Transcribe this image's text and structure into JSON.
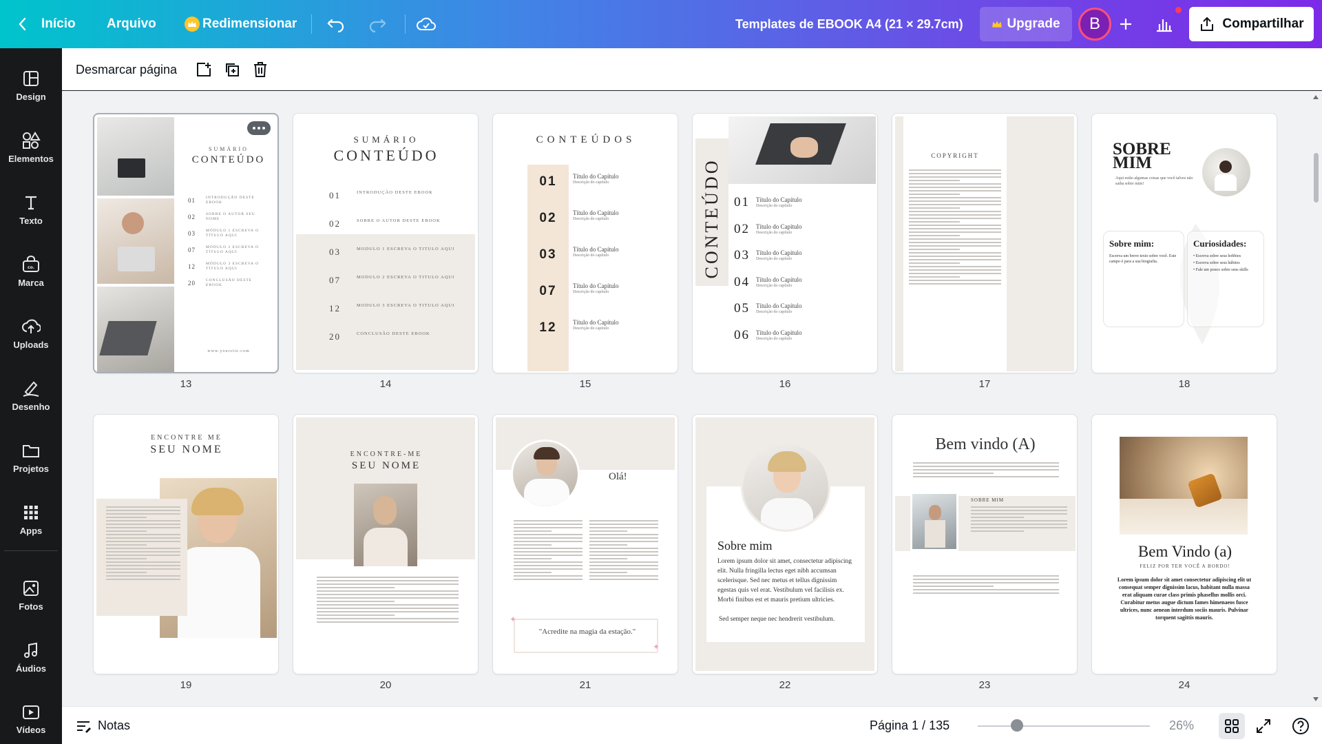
{
  "topbar": {
    "back_label": "Início",
    "file_label": "Arquivo",
    "resize_label": "Redimensionar",
    "doc_title": "Templates de EBOOK A4 (21 × 29.7cm)",
    "upgrade_label": "Upgrade",
    "avatar_initial": "B",
    "share_label": "Compartilhar",
    "colors": {
      "gradient_start": "#00c4cc",
      "gradient_end": "#7d2ae8",
      "avatar": "#7c1fb3"
    }
  },
  "sidebar": {
    "items": [
      {
        "label": "Design",
        "icon": "layout-icon"
      },
      {
        "label": "Elementos",
        "icon": "shapes-icon"
      },
      {
        "label": "Texto",
        "icon": "text-icon"
      },
      {
        "label": "Marca",
        "icon": "brand-icon"
      },
      {
        "label": "Uploads",
        "icon": "upload-cloud-icon"
      },
      {
        "label": "Desenho",
        "icon": "draw-icon"
      },
      {
        "label": "Projetos",
        "icon": "folder-icon"
      },
      {
        "label": "Apps",
        "icon": "apps-grid-icon"
      },
      {
        "label": "Fotos",
        "icon": "photo-icon"
      },
      {
        "label": "Áudios",
        "icon": "music-icon"
      },
      {
        "label": "Vídeos",
        "icon": "video-icon"
      }
    ]
  },
  "pagebar": {
    "deselect_label": "Desmarcar página"
  },
  "pages": {
    "p13": {
      "number": "13",
      "subtitle": "SUMÁRIO",
      "title": "CONTEÚDO",
      "items": [
        {
          "num": "01",
          "text": "INTRODUÇÃO DESTE EBOOK"
        },
        {
          "num": "02",
          "text": "SOBRE O AUTOR SEU NOME"
        },
        {
          "num": "03",
          "text": "MÓDULO 1 ESCREVA O TÍTULO AQUI"
        },
        {
          "num": "07",
          "text": "MÓDULO 2 ESCREVA O TÍTULO AQUI"
        },
        {
          "num": "12",
          "text": "MÓDULO 3 ESCREVA O TÍTULO AQUI"
        },
        {
          "num": "20",
          "text": "CONCLUSÃO DESTE EBOOK"
        }
      ],
      "url": "www.yoursite.com"
    },
    "p14": {
      "number": "14",
      "subtitle": "SUMÁRIO",
      "title": "CONTEÚDO",
      "items": [
        {
          "num": "01",
          "text": "INTRODUÇÃO DESTE EBOOK"
        },
        {
          "num": "02",
          "text": "SOBRE O AUTOR DESTE EBOOK"
        },
        {
          "num": "03",
          "text": "MODULO 1 ESCREVA O TITULO AQUI"
        },
        {
          "num": "07",
          "text": "MODULO 2 ESCREVA O TITULO AQUI"
        },
        {
          "num": "12",
          "text": "MODULO 3 ESCREVA O TITULO AQUI"
        },
        {
          "num": "20",
          "text": "CONCLUSÃO DESTE EBOOK"
        }
      ]
    },
    "p15": {
      "number": "15",
      "title": "CONTEÚDOS",
      "items": [
        {
          "num": "01",
          "title": "Título do Capítulo",
          "desc": "Descrição do capítulo"
        },
        {
          "num": "02",
          "title": "Título do Capítulo",
          "desc": "Descrição do capítulo"
        },
        {
          "num": "03",
          "title": "Título do Capítulo",
          "desc": "Descrição do capítulo"
        },
        {
          "num": "07",
          "title": "Título do Capítulo",
          "desc": "Descrição do capítulo"
        },
        {
          "num": "12",
          "title": "Título do Capítulo",
          "desc": "Descrição do capítulo"
        }
      ]
    },
    "p16": {
      "number": "16",
      "title": "CONTEÚDO",
      "items": [
        {
          "num": "01",
          "title": "Título do Capítulo",
          "desc": "Descrição do capítulo"
        },
        {
          "num": "02",
          "title": "Título do Capítulo",
          "desc": "Descrição do capítulo"
        },
        {
          "num": "03",
          "title": "Título do Capítulo",
          "desc": "Descrição do capítulo"
        },
        {
          "num": "04",
          "title": "Título do Capítulo",
          "desc": "Descrição do capítulo"
        },
        {
          "num": "05",
          "title": "Título do Capítulo",
          "desc": "Descrição do capítulo"
        },
        {
          "num": "06",
          "title": "Título do Capítulo",
          "desc": "Descrição do capítulo"
        }
      ]
    },
    "p17": {
      "number": "17",
      "title": "COPYRIGHT"
    },
    "p18": {
      "number": "18",
      "title": "SOBRE MIM",
      "tagline": "Aqui estão algumas coisas que você talvez não saiba sobre mim!",
      "box1_title": "Sobre mim:",
      "box1_text": "Escreva um breve texto sobre você. Este campo é para a sua biografia.",
      "box2_title": "Curiosidades:",
      "box2_items": [
        "Escreva sobre seus hobbies",
        "Escreva sobre seus hábitos",
        "Fale um pouco sobre seus skills"
      ]
    },
    "p19": {
      "number": "19",
      "subtitle": "ENCONTRE ME",
      "title": "SEU NOME"
    },
    "p20": {
      "number": "20",
      "subtitle": "ENCONTRE-ME",
      "title": "SEU NOME"
    },
    "p21": {
      "number": "21",
      "greeting": "Olá!",
      "quote": "\"Acredite na magia da estação.\""
    },
    "p22": {
      "number": "22",
      "title": "Sobre mim",
      "body": "Lorem ipsum dolor sit amet, consectetur adipiscing elit. Nulla fringilla lectus eget nibh accumsan scelerisque. Sed nec metus et tellus dignissim egestas quis vel erat. Vestibulum vel facilisis ex. Morbi finibus est et mauris pretium ultricies.",
      "body2": "Sed semper neque nec hendrerit vestibulum."
    },
    "p23": {
      "number": "23",
      "title": "Bem vindo (A)",
      "section": "SOBRE MIM"
    },
    "p24": {
      "number": "24",
      "title": "Bem Vindo (a)",
      "subtitle": "FELIZ POR TER VOCÊ A BORDO!",
      "body": "Lorem ipsum dolor sit amet consectetur adipiscing elit ut consequat semper dignissim lacus, habitant nulla massa erat aliquam curae class primis phasellus mollis orci. Curabitur metus augue dictum fames himenaeos fusce ultrices, nunc aenean interdum sociis mauris. Pulvinar torquent sagittis mauris."
    }
  },
  "footer": {
    "notes_label": "Notas",
    "page_indicator": "Página 1 / 135",
    "zoom_label": "26%",
    "zoom_value_percent": 26
  }
}
